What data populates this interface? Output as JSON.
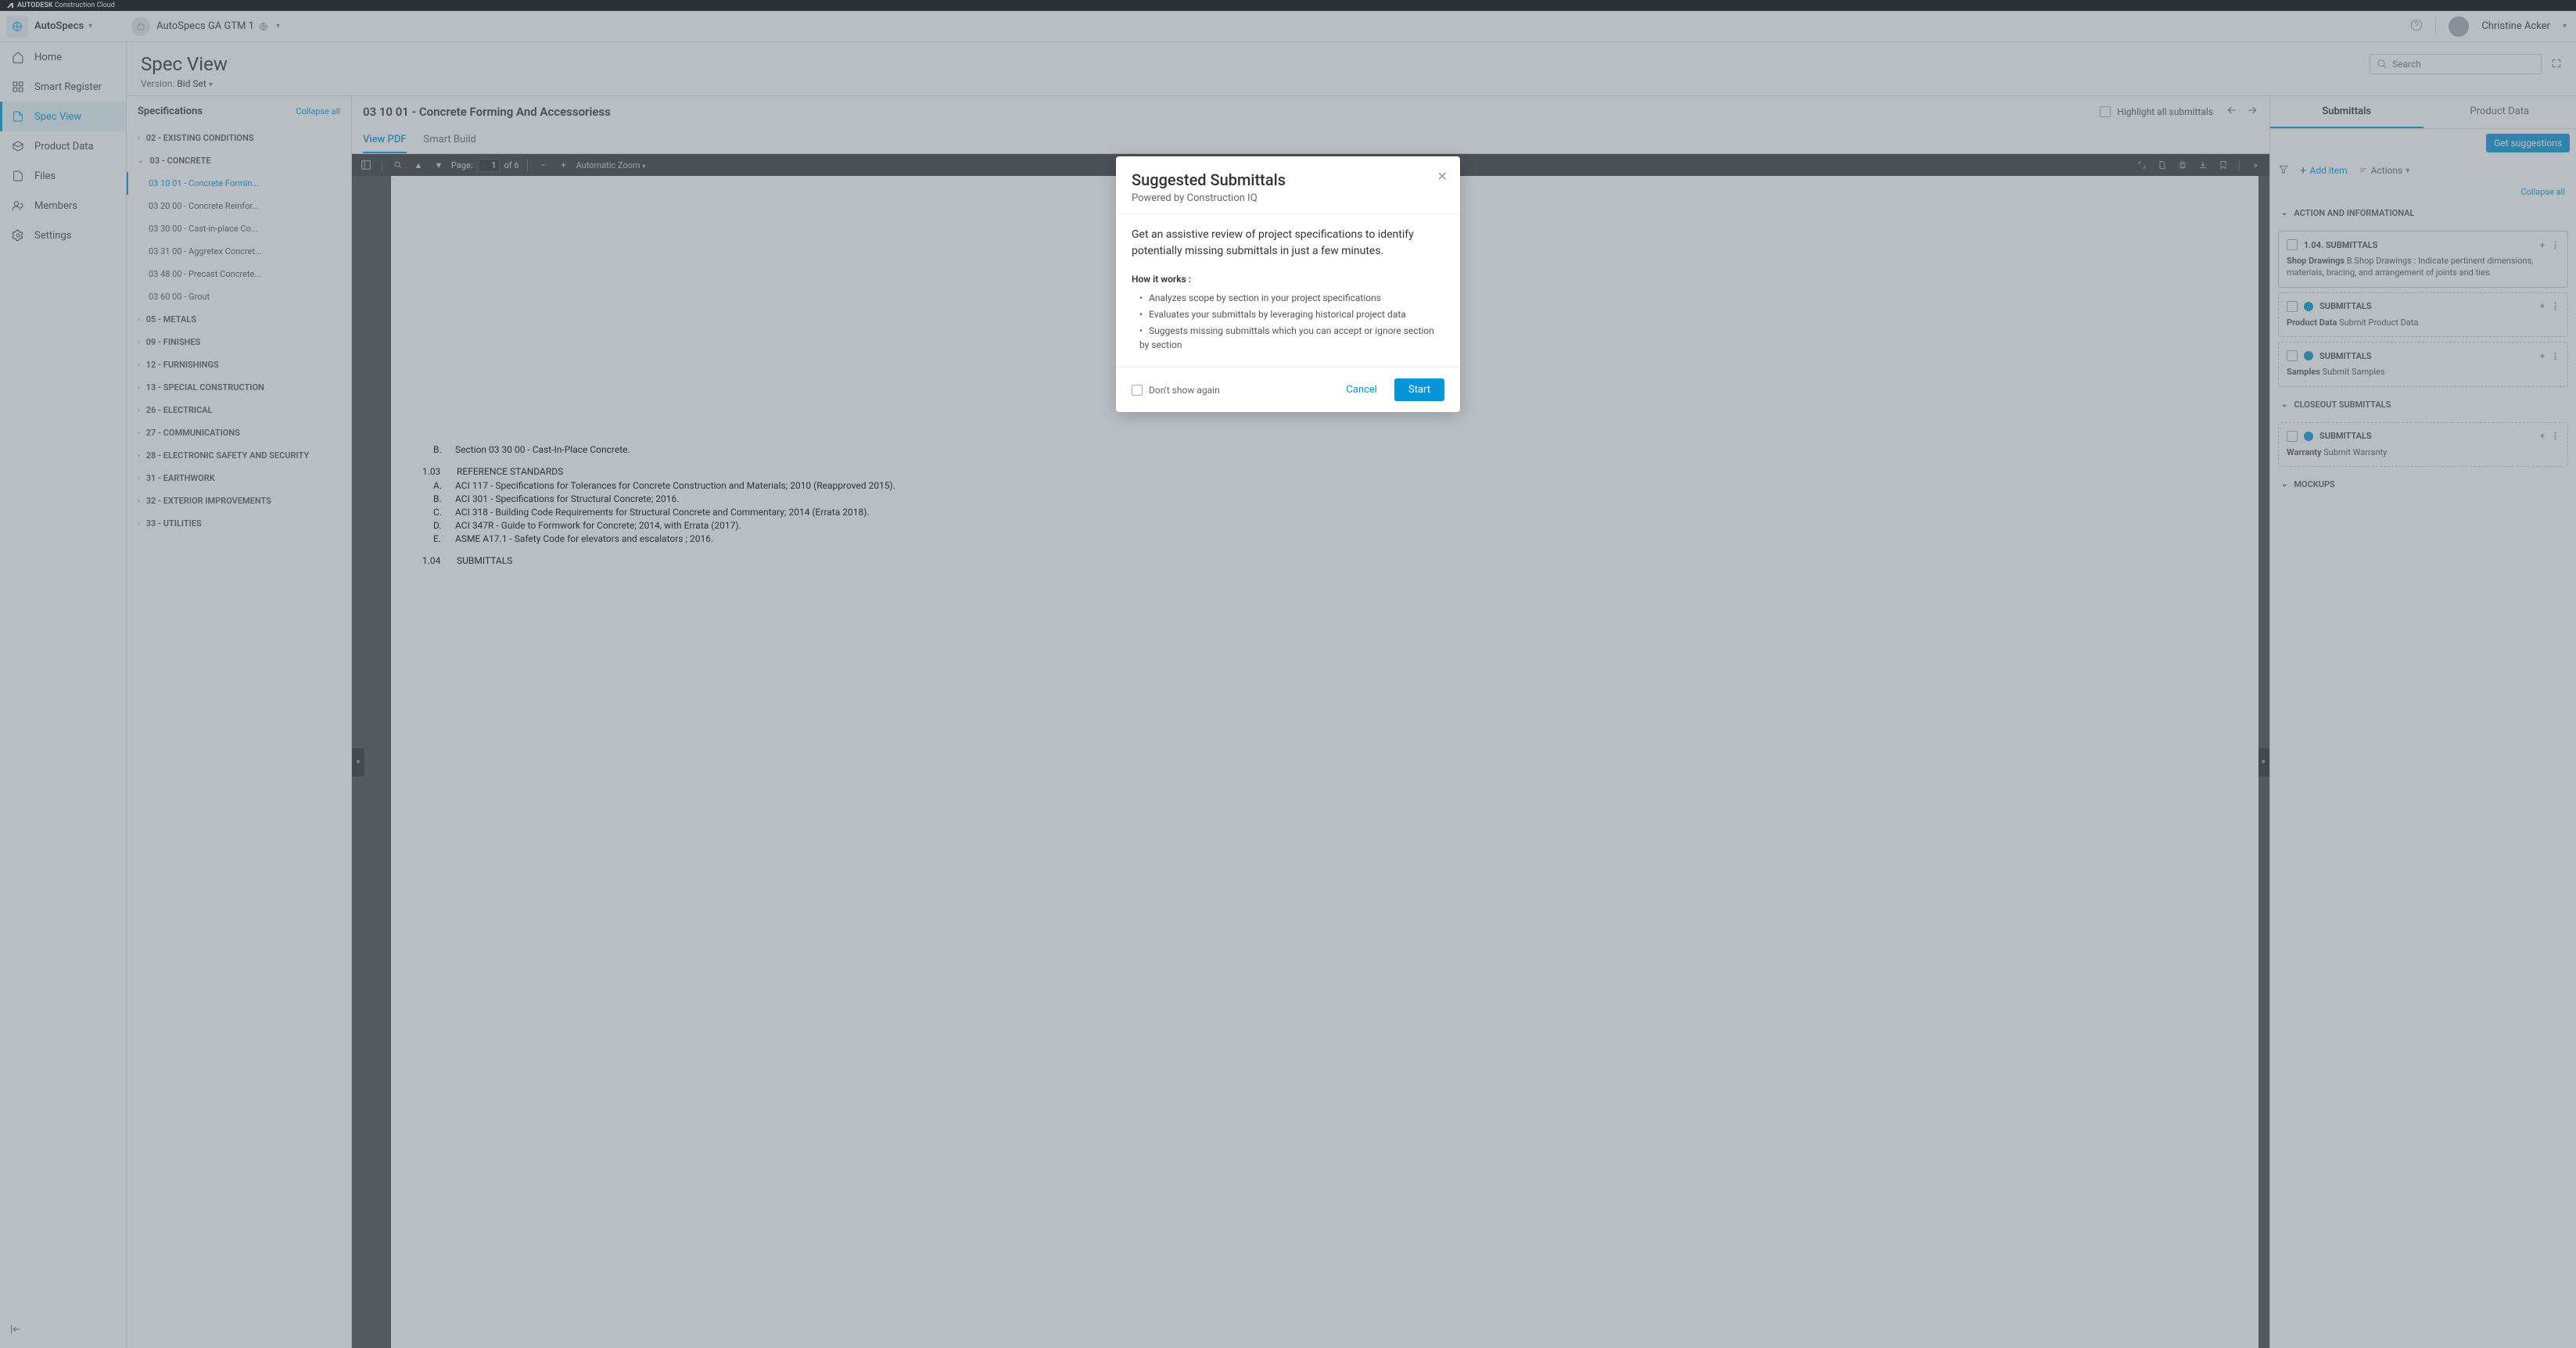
{
  "brand": {
    "platform": "Construction Cloud"
  },
  "header": {
    "app_name": "AutoSpecs",
    "project_name": "AutoSpecs GA GTM 1",
    "user_name": "Christine Acker"
  },
  "sidebar": {
    "items": [
      {
        "label": "Home"
      },
      {
        "label": "Smart Register"
      },
      {
        "label": "Spec View"
      },
      {
        "label": "Product Data"
      },
      {
        "label": "Files"
      },
      {
        "label": "Members"
      },
      {
        "label": "Settings"
      }
    ]
  },
  "page": {
    "title": "Spec View",
    "version_label": "Version:",
    "version_value": "Bid Set",
    "search_placeholder": "Search"
  },
  "specs": {
    "title": "Specifications",
    "collapse_all": "Collapse all",
    "groups": [
      {
        "label": "02 - EXISTING CONDITIONS",
        "expanded": false
      },
      {
        "label": "03 - CONCRETE",
        "expanded": true,
        "items": [
          {
            "label": "03 10 01 - Concrete Formin...",
            "active": true
          },
          {
            "label": "03 20 00 - Concrete Reinfor..."
          },
          {
            "label": "03 30 00 - Cast-in-place Co..."
          },
          {
            "label": "03 31 00 - Aggretex Concret..."
          },
          {
            "label": "03 48 00 - Precast Concrete..."
          },
          {
            "label": "03 60 00 - Grout"
          }
        ]
      },
      {
        "label": "05 - METALS",
        "expanded": false
      },
      {
        "label": "09 - FINISHES",
        "expanded": false
      },
      {
        "label": "12 - FURNISHINGS",
        "expanded": false
      },
      {
        "label": "13 - SPECIAL CONSTRUCTION",
        "expanded": false
      },
      {
        "label": "26 - ELECTRICAL",
        "expanded": false
      },
      {
        "label": "27 - COMMUNICATIONS",
        "expanded": false
      },
      {
        "label": "28 - ELECTRONIC SAFETY AND SECURITY",
        "expanded": false
      },
      {
        "label": "31 - EARTHWORK",
        "expanded": false
      },
      {
        "label": "32 - EXTERIOR IMPROVEMENTS",
        "expanded": false
      },
      {
        "label": "33 - UTILITIES",
        "expanded": false
      }
    ]
  },
  "center": {
    "section_title": "03 10 01 - Concrete Forming And Accessoriess",
    "highlight_label": "Highlight all submittals",
    "tabs": [
      {
        "label": "View PDF",
        "active": true
      },
      {
        "label": "Smart Build"
      }
    ]
  },
  "pdf_toolbar": {
    "page_label": "Page:",
    "current_page": "1",
    "total_pages": "of 6",
    "zoom_label": "Automatic Zoom"
  },
  "pdf_content": {
    "related_b": "Section 03 30 00 - Cast-In-Place Concrete.",
    "ref_num": "1.03",
    "ref_title": "REFERENCE STANDARDS",
    "ref_items": [
      {
        "l": "A.",
        "t": "ACI 117 - Specifications for Tolerances for Concrete Construction and Materials; 2010 (Reapproved 2015)."
      },
      {
        "l": "B.",
        "t": "ACI 301 - Specifications for Structural Concrete; 2016."
      },
      {
        "l": "C.",
        "t": "ACI 318 - Building Code Requirements for Structural Concrete and Commentary; 2014 (Errata 2018)."
      },
      {
        "l": "D.",
        "t": "ACI 347R - Guide to Formwork for Concrete; 2014, with Errata (2017)."
      },
      {
        "l": "E.",
        "t": "ASME A17.1 - Safety Code for elevators and escalators ; 2016."
      }
    ],
    "sub_num": "1.04",
    "sub_title": "SUBMITTALS"
  },
  "right": {
    "tabs": [
      {
        "label": "Submittals",
        "active": true
      },
      {
        "label": "Product Data"
      }
    ],
    "get_suggestions": "Get suggestions",
    "add_item": "Add item",
    "actions": "Actions",
    "collapse_all": "Collapse all",
    "groups": [
      {
        "title": "ACTION AND INFORMATIONAL",
        "items": [
          {
            "head": "1.04. SUBMITTALS",
            "desc_strong": "Shop Drawings",
            "desc": " B.Shop Drawings : Indicate pertinent dimensions, materials, bracing, and arrangement of joints and ties.",
            "solid": true,
            "globe": false
          },
          {
            "head": "SUBMITTALS",
            "desc_strong": "Product Data",
            "desc": " Submit Product Data",
            "globe": true
          },
          {
            "head": "SUBMITTALS",
            "desc_strong": "Samples",
            "desc": " Submit Samples",
            "globe": true
          }
        ]
      },
      {
        "title": "CLOSEOUT SUBMITTALS",
        "items": [
          {
            "head": "SUBMITTALS",
            "desc_strong": "Warranty",
            "desc": " Submit Warranty",
            "globe": true
          }
        ]
      },
      {
        "title": "MOCKUPS",
        "items": []
      }
    ]
  },
  "modal": {
    "title": "Suggested Submittals",
    "subtitle": "Powered by Construction IQ",
    "lead": "Get an assistive review of project specifications to identify potentially missing submittals in just a few minutes.",
    "how_it_works": "How it works :",
    "bullets": [
      "Analyzes scope by section in your project specifications",
      "Evaluates your submittals by leveraging historical project data",
      "Suggests missing submittals which you can accept or ignore section by section"
    ],
    "dont_show": "Don't show again",
    "cancel": "Cancel",
    "start": "Start"
  }
}
